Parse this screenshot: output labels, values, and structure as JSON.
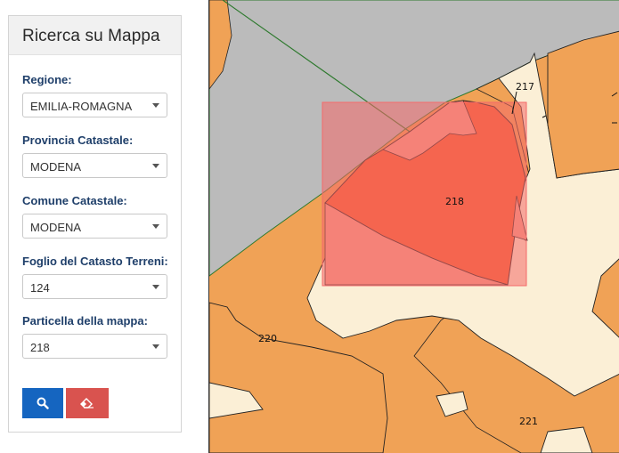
{
  "sidebar": {
    "title": "Ricerca su Mappa",
    "fields": [
      {
        "label": "Regione:",
        "value": "EMILIA-ROMAGNA"
      },
      {
        "label": "Provincia Catastale:",
        "value": "MODENA"
      },
      {
        "label": "Comune Catastale:",
        "value": "MODENA"
      },
      {
        "label": "Foglio del Catasto Terreni:",
        "value": "124"
      },
      {
        "label": "Particella della mappa:",
        "value": "218"
      }
    ],
    "buttons": {
      "search_icon": "search-icon",
      "clear_icon": "eraser-icon"
    }
  },
  "map": {
    "parcel_labels": [
      "217",
      "218",
      "220",
      "221"
    ],
    "colors": {
      "parcel": "#f0a256",
      "light_parcel": "#fbefd6",
      "road": "#bbbbbb",
      "selected": "#f65f30",
      "highlight_box": "#f46a6a"
    }
  }
}
